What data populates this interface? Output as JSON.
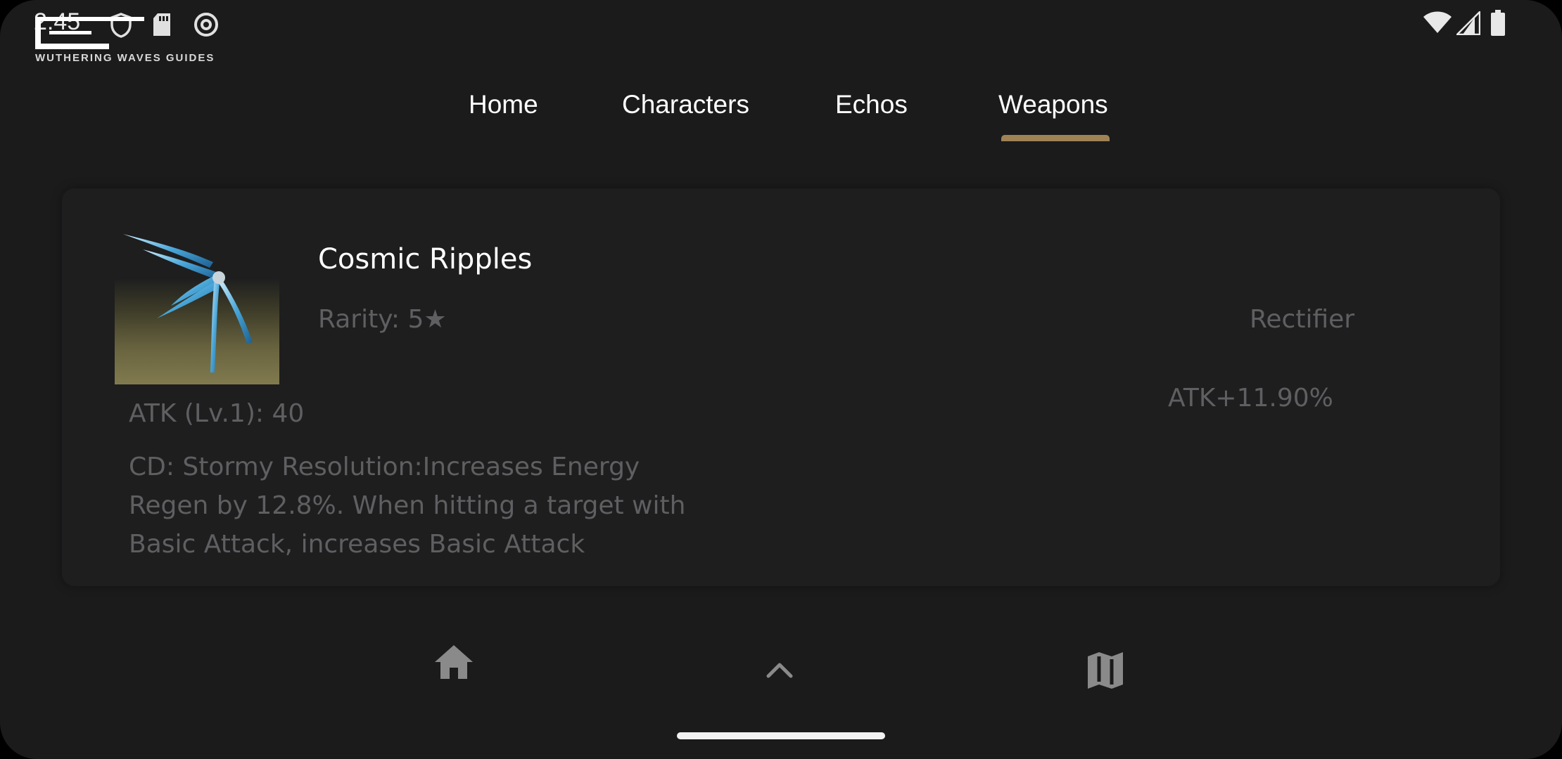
{
  "status_bar": {
    "time": "2:45",
    "icons": [
      "shield-icon",
      "sd-card-icon",
      "at-sign-icon",
      "wifi-icon",
      "cellular-signal-icon",
      "battery-icon"
    ]
  },
  "app": {
    "logo_text": "WUTHERING WAVES GUIDES"
  },
  "tabs": [
    {
      "label": "Home",
      "selected": false
    },
    {
      "label": "Characters",
      "selected": false
    },
    {
      "label": "Echos",
      "selected": false
    },
    {
      "label": "Weapons",
      "selected": true
    }
  ],
  "accent_color": "#a08355",
  "weapon": {
    "name": "Cosmic Ripples",
    "rarity": "Rarity: 5★",
    "type": "Rectifier",
    "substat": "ATK+11.90%",
    "base_atk": "ATK (Lv.1): 40",
    "passive": "CD: Stormy Resolution:Increases Energy Regen by 12.8%. When hitting a target with Basic Attack, increases Basic Attack"
  },
  "bottom_nav": [
    {
      "icon": "home-icon"
    },
    {
      "icon": "chevron-up-icon"
    },
    {
      "icon": "map-icon"
    }
  ]
}
